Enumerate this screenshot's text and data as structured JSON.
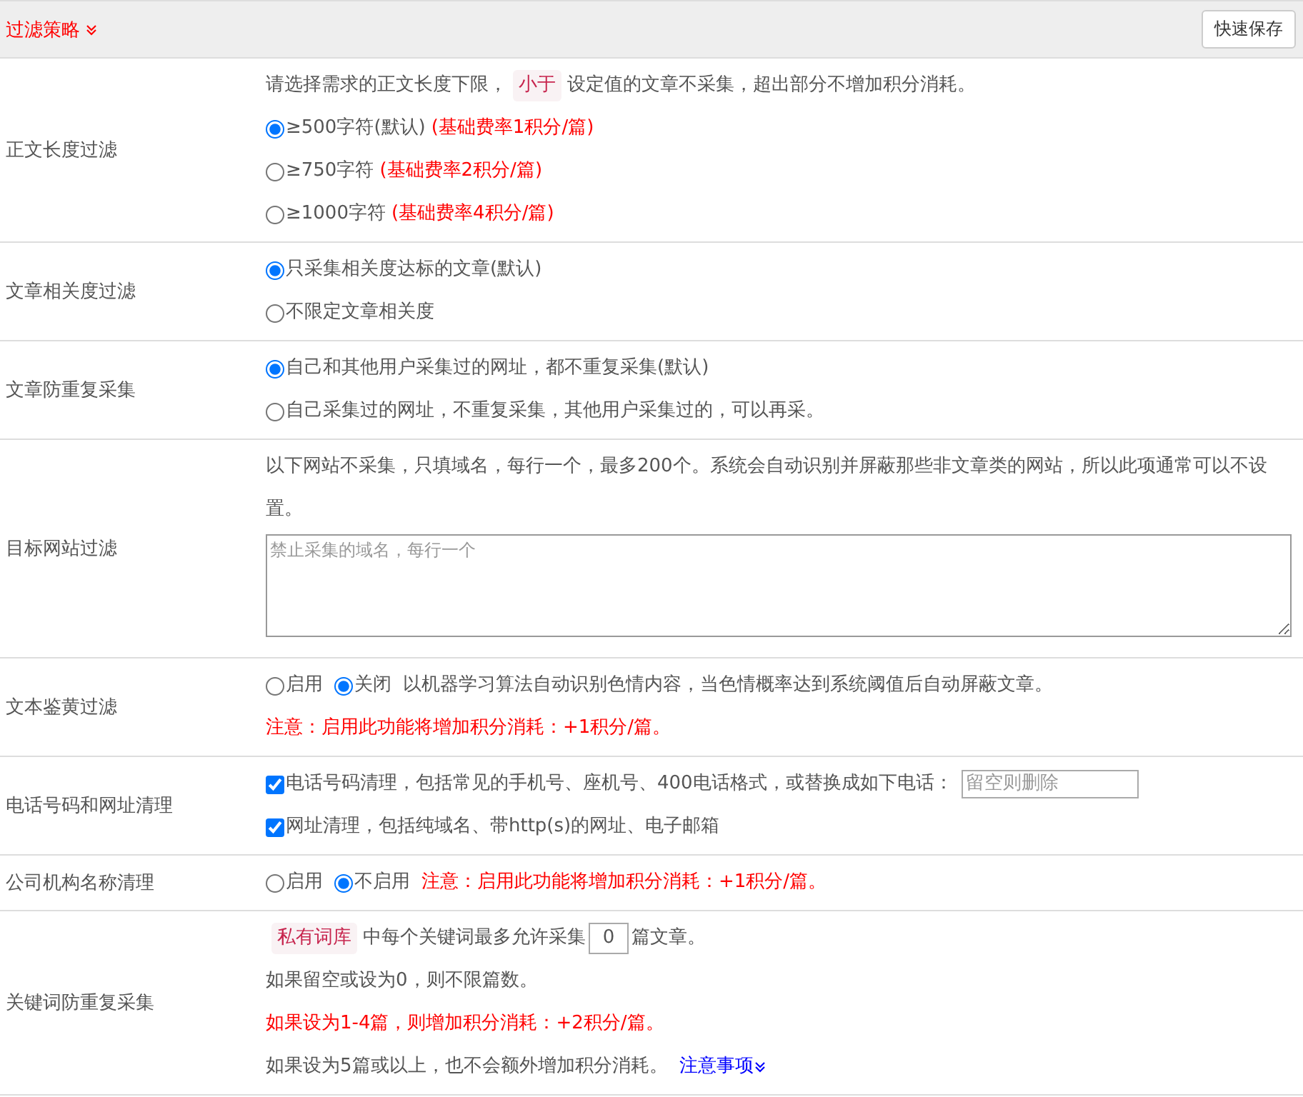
{
  "header": {
    "title": "过滤策略",
    "save_button": "快速保存"
  },
  "sections": [
    {
      "label": "正文长度过滤",
      "lines": [
        {
          "kind": "mixed",
          "segments": [
            {
              "kind": "text",
              "text": "请选择需求的正文长度下限，"
            },
            {
              "kind": "tag",
              "text": "小于"
            },
            {
              "kind": "text",
              "text": "设定值的文章不采集，超出部分不增加积分消耗。"
            }
          ]
        },
        {
          "kind": "radios",
          "options": [
            {
              "label": "≥500字符(默认)",
              "note": "(基础费率1积分/篇)",
              "selected": true
            }
          ]
        },
        {
          "kind": "radios",
          "options": [
            {
              "label": "≥750字符",
              "note": "(基础费率2积分/篇)",
              "selected": false
            }
          ]
        },
        {
          "kind": "radios",
          "options": [
            {
              "label": "≥1000字符",
              "note": "(基础费率4积分/篇)",
              "selected": false
            }
          ]
        }
      ]
    },
    {
      "label": "文章相关度过滤",
      "lines": [
        {
          "kind": "radios",
          "options": [
            {
              "label": "只采集相关度达标的文章(默认)",
              "selected": true
            }
          ]
        },
        {
          "kind": "radios",
          "options": [
            {
              "label": "不限定文章相关度",
              "selected": false
            }
          ]
        }
      ]
    },
    {
      "label": "文章防重复采集",
      "lines": [
        {
          "kind": "radios",
          "options": [
            {
              "label": "自己和其他用户采集过的网址，都不重复采集(默认)",
              "selected": true
            }
          ]
        },
        {
          "kind": "radios",
          "options": [
            {
              "label": "自己采集过的网址，不重复采集，其他用户采集过的，可以再采。",
              "selected": false
            }
          ]
        }
      ]
    },
    {
      "label": "目标网站过滤",
      "lines": [
        {
          "kind": "text",
          "text": "以下网站不采集，只填域名，每行一个，最多200个。系统会自动识别并屏蔽那些非文章类的网站，所以此项通常可以不设置。"
        },
        {
          "kind": "textarea",
          "placeholder": "禁止采集的域名，每行一个"
        }
      ]
    },
    {
      "label": "文本鉴黄过滤",
      "lines": [
        {
          "kind": "radios",
          "options": [
            {
              "label": "启用",
              "selected": false
            },
            {
              "label": "关闭",
              "selected": true
            }
          ],
          "description": "以机器学习算法自动识别色情内容，当色情概率达到系统阈值后自动屏蔽文章。"
        },
        {
          "kind": "warning",
          "text": "注意：启用此功能将增加积分消耗：+1积分/篇。"
        }
      ]
    },
    {
      "label": "电话号码和网址清理",
      "lines": [
        {
          "kind": "checkbox",
          "label": "电话号码清理，包括常见的手机号、座机号、400电话格式，或替换成如下电话：",
          "checked": true,
          "placeholder": "留空则删除"
        },
        {
          "kind": "checkbox",
          "label": "网址清理，包括纯域名、带http(s)的网址、电子邮箱",
          "checked": true
        }
      ]
    },
    {
      "label": "公司机构名称清理",
      "lines": [
        {
          "kind": "radios",
          "options": [
            {
              "label": "启用",
              "selected": false
            },
            {
              "label": "不启用",
              "selected": true
            }
          ],
          "warning": "注意：启用此功能将增加积分消耗：+1积分/篇。"
        }
      ]
    },
    {
      "label": "关键词防重复采集",
      "lines": [
        {
          "kind": "mixed",
          "segments": [
            {
              "kind": "tag",
              "text": "私有词库"
            },
            {
              "kind": "text",
              "text": "中每个关键词最多允许采集"
            },
            {
              "kind": "input",
              "text": "0"
            },
            {
              "kind": "text",
              "text": "篇文章。"
            }
          ]
        },
        {
          "kind": "text",
          "text": "如果留空或设为0，则不限篇数。"
        },
        {
          "kind": "warning",
          "text": "如果设为1-4篇，则增加积分消耗：+2积分/篇。"
        },
        {
          "kind": "mixed",
          "segments": [
            {
              "kind": "text",
              "text": "如果设为5篇或以上，也不会额外增加积分消耗。"
            },
            {
              "kind": "link",
              "text": "注意事项"
            }
          ]
        }
      ]
    }
  ]
}
